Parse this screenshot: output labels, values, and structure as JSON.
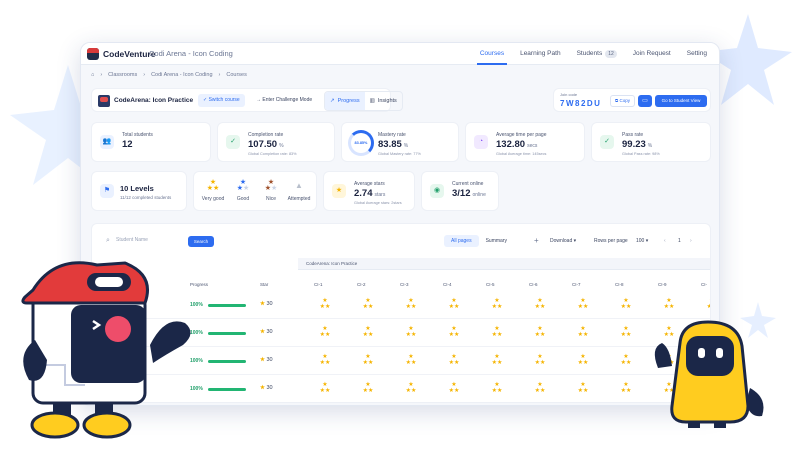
{
  "app": {
    "logo_text": "CodeVenture",
    "title": "Codi Arena - Icon Coding"
  },
  "nav": [
    {
      "label": "Courses",
      "active": true
    },
    {
      "label": "Learning Path"
    },
    {
      "label": "Students",
      "badge": "12"
    },
    {
      "label": "Join Request"
    },
    {
      "label": "Setting"
    }
  ],
  "breadcrumb": [
    "Classrooms",
    "Codi Arena - Icon Coding",
    "Courses"
  ],
  "course": {
    "name": "CodeArena: Icon Practice",
    "switch_label": "Switch course",
    "challenge_label": "Enter Challenge Mode",
    "modes": [
      "Progress",
      "Insights"
    ]
  },
  "join": {
    "label": "Join code",
    "code": "7W82DU",
    "copy_label": "Copy",
    "student_view_label": "Go to Student View"
  },
  "stats": {
    "total_students": {
      "label": "Total students",
      "value": "12"
    },
    "completion": {
      "label": "Completion rate",
      "value": "107.50",
      "unit": "%",
      "sub": "Global Completion rate: 83%"
    },
    "mastery": {
      "label": "Mastery rate",
      "value": "83.85",
      "unit": "%",
      "ring": "83.85%",
      "sub": "Global Mastery rate: 77%"
    },
    "avg_time": {
      "label": "Average time per page",
      "value": "132.80",
      "unit": "secs",
      "sub": "Global Average time: 145secs"
    },
    "pass": {
      "label": "Pass rate",
      "value": "99.23",
      "unit": "%",
      "sub": "Global Pass rate: 98%"
    },
    "levels": {
      "title": "10 Levels",
      "sub": "11/12 completed students"
    },
    "avg_stars": {
      "label": "Average stars",
      "value": "2.74",
      "unit": "stars",
      "sub": "Global Average stars: 2stars"
    },
    "online": {
      "label": "Current online",
      "value": "3/12",
      "unit": "online"
    }
  },
  "ratings": [
    {
      "label": "Very good",
      "stars": "★\n★★"
    },
    {
      "label": "Good",
      "stars": "★\n★☆"
    },
    {
      "label": "Nice",
      "stars": "★\n★☆"
    },
    {
      "label": "Attempted",
      "stars": "▲"
    }
  ],
  "table": {
    "search_placeholder": "Student Name",
    "search_button": "Search",
    "tabs": [
      "All pages",
      "Summary"
    ],
    "download_label": "Download",
    "rows_per_page_label": "Rows per page",
    "rows_per_page_value": "100",
    "page": "1",
    "col_progress": "Progress",
    "col_star": "Star",
    "section_title": "CodeArena: Icon Practice",
    "levels": [
      "CI-1",
      "CI-2",
      "CI-3",
      "CI-4",
      "CI-5",
      "CI-6",
      "CI-7",
      "CI-8",
      "CI-9",
      "CI-"
    ],
    "rows": [
      {
        "progress": "100%",
        "fill": 1.0,
        "stars": "30"
      },
      {
        "progress": "100%",
        "fill": 1.0,
        "stars": "30"
      },
      {
        "progress": "100%",
        "fill": 1.0,
        "stars": "30"
      },
      {
        "progress": "100%",
        "fill": 1.0,
        "stars": "30"
      }
    ]
  }
}
